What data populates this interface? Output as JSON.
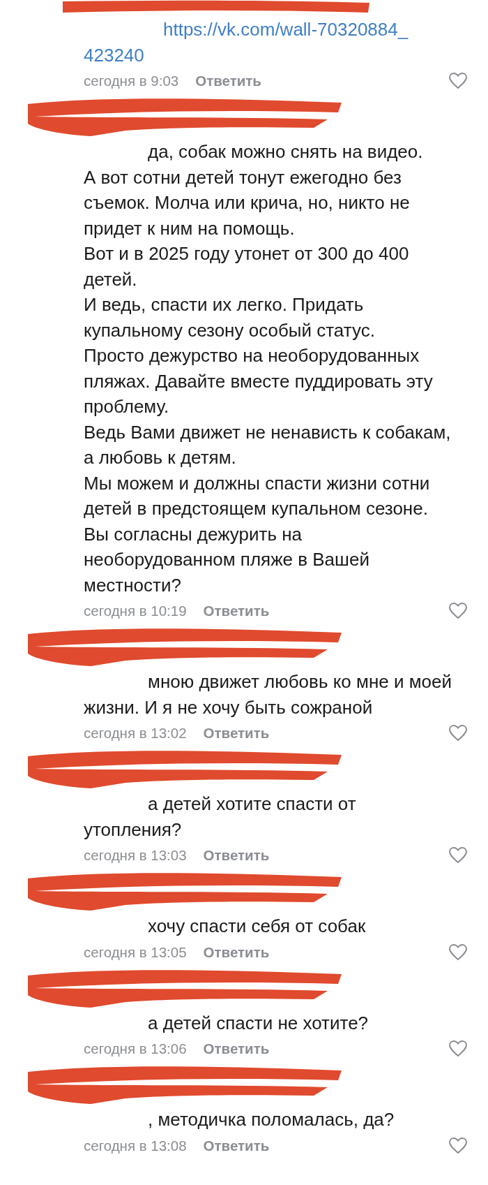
{
  "comments": [
    {
      "link": "https://vk.com/wall-70320884_423240",
      "time": "сегодня в 9:03",
      "reply": "Ответить",
      "liked": false
    },
    {
      "text": "да, собак можно снять на видео.\nА вот сотни детей тонут ежегодно без съемок. Молча или крича, но, никто не придет к ним на помощь.\nВот и в 2025 году утонет от 300 до 400 детей.\nИ ведь, спасти их легко. Придать купальному сезону особый статус.\nПросто дежурство на необорудованных пляжах.  Давайте вместе пуддировать эту проблему.\nВедь Вами движет не ненависть к собакам, а любовь к детям.\nМы можем и должны спасти жизни сотни детей в предстоящем купальном сезоне.\nВы согласны дежурить на необорудованном пляже в Вашей местности?",
      "time": "сегодня в 10:19",
      "reply": "Ответить",
      "liked": false
    },
    {
      "text": "мною движет любовь ко мне и моей жизни. И я не хочу быть сожраной",
      "time": "сегодня в 13:02",
      "reply": "Ответить",
      "liked": false
    },
    {
      "text": "а детей хотите спасти от утопления?",
      "time": "сегодня в 13:03",
      "reply": "Ответить",
      "liked": false
    },
    {
      "text": "хочу спасти себя от собак",
      "time": "сегодня в 13:05",
      "reply": "Ответить",
      "liked": false
    },
    {
      "text": "а детей спасти не хотите?",
      "time": "сегодня в 13:06",
      "reply": "Ответить",
      "liked": false
    },
    {
      "text": ", методичка поломалась, да?",
      "time": "сегодня в 13:08",
      "reply": "Ответить",
      "liked": false
    }
  ]
}
